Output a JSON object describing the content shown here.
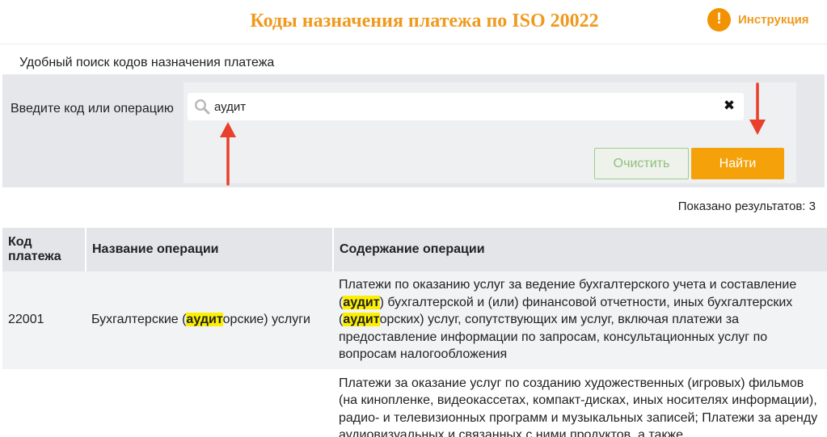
{
  "header": {
    "title": "Коды назначения платежа по ISO 20022",
    "help_icon_glyph": "!",
    "help_label": "Инструкция"
  },
  "subtitle": "Удобный поиск кодов назначения платежа",
  "search": {
    "label": "Введите код или операцию",
    "value": "аудит",
    "clear_icon_glyph": "✖",
    "clear_button": "Очистить",
    "find_button": "Найти"
  },
  "results_count": "Показано результатов: 3",
  "table": {
    "columns": [
      "Код платежа",
      "Название операции",
      "Содержание операции"
    ],
    "rows": [
      {
        "code": "22001",
        "name_parts": [
          "Бухгалтерские (",
          "аудит",
          "орские) услуги"
        ],
        "desc_parts": [
          "Платежи по оказанию услуг за ведение бухгалтерского учета и составление (",
          "аудит",
          ") бухгалтерской и (или) финансовой отчетности, иных бухгалтерских (",
          "аудит",
          "орских) услуг, сопутствующих им услуг, включая платежи за предоставление информации по запросам, консультационных услуг по вопросам налогообложения"
        ]
      },
      {
        "code": "",
        "name_parts": [
          "",
          "",
          ""
        ],
        "desc_parts": [
          "Платежи за оказание услуг по созданию художественных (игровых) фильмов (на кинопленке, видеокассетах, компакт-дисках, иных носителях информации), радио- и телевизионных программ и музыкальных записей; Платежи за аренду аудиовизуальных и связанных с ними продуктов, а также"
        ]
      }
    ]
  },
  "colors": {
    "accent_orange": "#f39200",
    "title_orange": "#ef9a1e",
    "highlight_yellow": "#fcf000",
    "annotation_red": "#e8402b",
    "clear_button_border": "#9bcf8a"
  }
}
